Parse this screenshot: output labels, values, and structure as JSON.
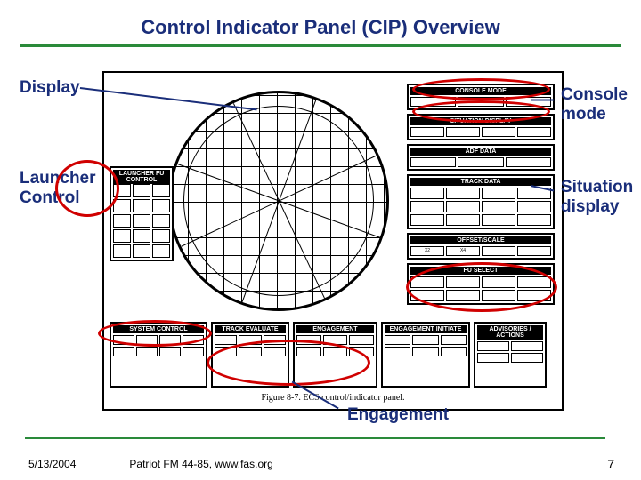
{
  "title": "Control Indicator Panel (CIP) Overview",
  "callouts": {
    "display": "Display",
    "launcher_control_line1": "Launcher",
    "launcher_control_line2": "Control",
    "console_mode_line1": "Console",
    "console_mode_line2": "mode",
    "situation_display_line1": "Situation",
    "situation_display_line2": "display",
    "engagement": "Engagement"
  },
  "figure": {
    "caption": "Figure 8-7. ECS control/indicator panel.",
    "panels": {
      "console_mode_hdr": "CONSOLE MODE",
      "situation_display_hdr": "SITUATION DISPLAY",
      "adf_data_hdr": "ADF DATA",
      "track_data_hdr": "TRACK DATA",
      "offset_scale_hdr": "OFFSET/SCALE",
      "system_control_hdr": "SYSTEM CONTROL",
      "track_evaluate_hdr": "TRACK EVALUATE",
      "engagement_hdr": "ENGAGEMENT",
      "fu_select_hdr": "FU SELECT",
      "engagement_initiate_hdr": "ENGAGEMENT INITIATE",
      "advisories_hdr": "ADVISORIES / ACTIONS",
      "launcher_hdr": "LAUNCHER FU CONTROL"
    }
  },
  "footer": {
    "date": "5/13/2004",
    "credit": "Patriot FM 44-85, www.fas.org",
    "page": "7"
  }
}
